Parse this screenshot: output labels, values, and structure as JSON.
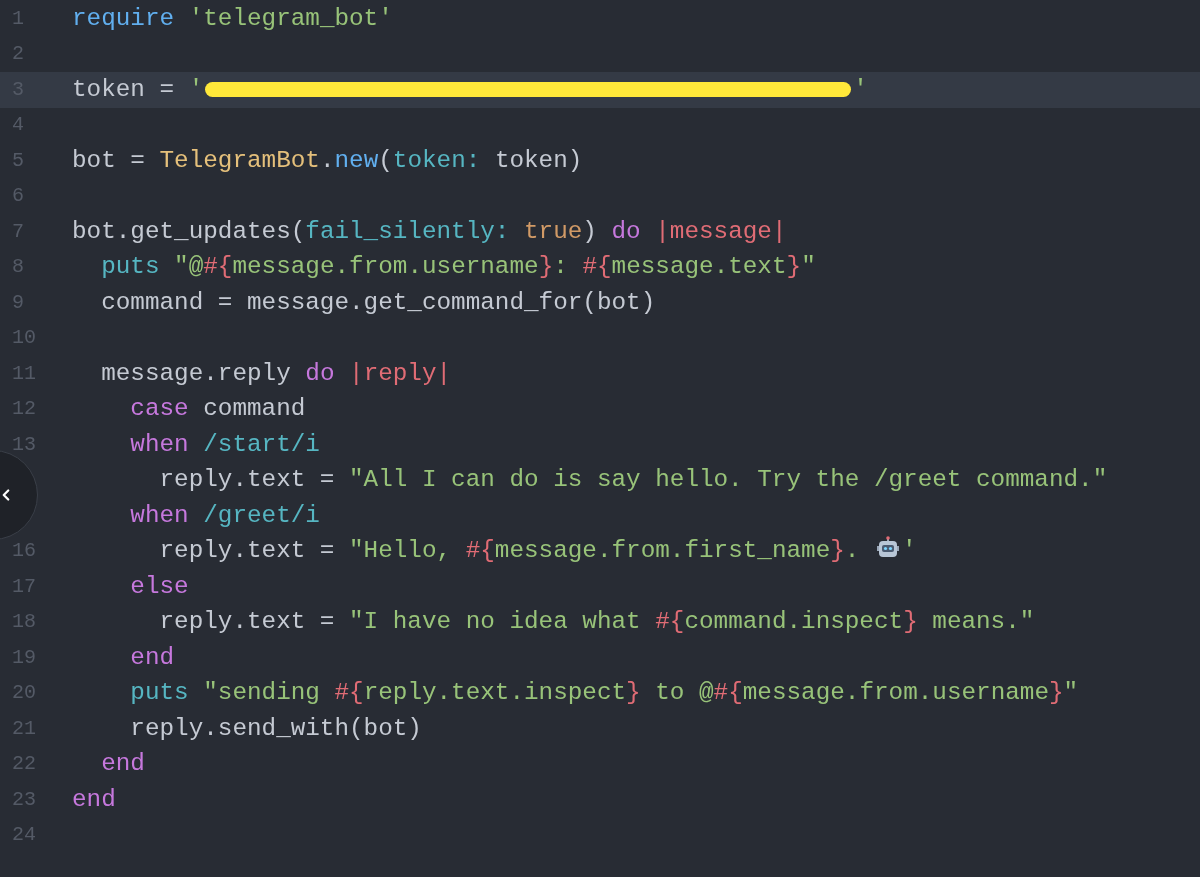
{
  "editor": {
    "lines": [
      {
        "number": "1",
        "current": false,
        "tokens": [
          {
            "kind": "function",
            "text": "require "
          },
          {
            "kind": "string",
            "text": "'telegram_bot'"
          }
        ]
      },
      {
        "number": "2",
        "current": false
      },
      {
        "number": "3",
        "current": true,
        "tokens": [
          {
            "kind": "plain",
            "text": "token = "
          },
          {
            "kind": "string",
            "text": "'"
          },
          {
            "kind": "redacted"
          },
          {
            "kind": "string",
            "text": "'"
          }
        ]
      },
      {
        "number": "4",
        "current": false
      },
      {
        "number": "5",
        "current": false,
        "tokens": [
          {
            "kind": "plain",
            "text": "bot = "
          },
          {
            "kind": "constant",
            "text": "TelegramBot"
          },
          {
            "kind": "plain",
            "text": "."
          },
          {
            "kind": "function",
            "text": "new"
          },
          {
            "kind": "plain",
            "text": "("
          },
          {
            "kind": "symbol",
            "text": "token:"
          },
          {
            "kind": "plain",
            "text": " token)"
          }
        ]
      },
      {
        "number": "6",
        "current": false
      },
      {
        "number": "7",
        "current": false,
        "tokens": [
          {
            "kind": "plain",
            "text": "bot.get_updates("
          },
          {
            "kind": "symbol",
            "text": "fail_silently: "
          },
          {
            "kind": "boolean",
            "text": "true"
          },
          {
            "kind": "plain",
            "text": ") "
          },
          {
            "kind": "keyword",
            "text": "do "
          },
          {
            "kind": "interpolation",
            "text": "|message|"
          }
        ]
      },
      {
        "number": "8",
        "current": false,
        "tokens": [
          {
            "kind": "symbol",
            "text": "  puts "
          },
          {
            "kind": "string",
            "text": "\"@"
          },
          {
            "kind": "interpolation",
            "text": "#{"
          },
          {
            "kind": "string",
            "text": "message.from.username"
          },
          {
            "kind": "interpolation",
            "text": "}"
          },
          {
            "kind": "string",
            "text": ": "
          },
          {
            "kind": "interpolation",
            "text": "#{"
          },
          {
            "kind": "string",
            "text": "message.text"
          },
          {
            "kind": "interpolation",
            "text": "}"
          },
          {
            "kind": "string",
            "text": "\""
          }
        ]
      },
      {
        "number": "9",
        "current": false,
        "tokens": [
          {
            "kind": "plain",
            "text": "  command = message.get_command_for(bot)"
          }
        ]
      },
      {
        "number": "10",
        "current": false
      },
      {
        "number": "11",
        "current": false,
        "tokens": [
          {
            "kind": "plain",
            "text": "  message.reply "
          },
          {
            "kind": "keyword",
            "text": "do "
          },
          {
            "kind": "interpolation",
            "text": "|reply|"
          }
        ]
      },
      {
        "number": "12",
        "current": false,
        "tokens": [
          {
            "kind": "keyword",
            "text": "    case"
          },
          {
            "kind": "plain",
            "text": " command"
          }
        ]
      },
      {
        "number": "13",
        "current": false,
        "tokens": [
          {
            "kind": "keyword",
            "text": "    when "
          },
          {
            "kind": "symbol",
            "text": "/start/i"
          }
        ]
      },
      {
        "current": false,
        "tokens": [
          {
            "kind": "plain",
            "text": "      reply.text = "
          },
          {
            "kind": "string",
            "text": "\"All I can do is say hello. Try the /greet command.\""
          }
        ]
      },
      {
        "current": false,
        "tokens": [
          {
            "kind": "keyword",
            "text": "    when "
          },
          {
            "kind": "symbol",
            "text": "/greet/i"
          }
        ]
      },
      {
        "number": "16",
        "current": false,
        "tokens": [
          {
            "kind": "plain",
            "text": "      reply.text = "
          },
          {
            "kind": "string",
            "text": "\"Hello, "
          },
          {
            "kind": "interpolation",
            "text": "#{"
          },
          {
            "kind": "string",
            "text": "message.from.first_name"
          },
          {
            "kind": "interpolation",
            "text": "}"
          },
          {
            "kind": "string",
            "text": ". "
          },
          {
            "kind": "emoji"
          },
          {
            "kind": "string",
            "text": "'"
          }
        ]
      },
      {
        "number": "17",
        "current": false,
        "tokens": [
          {
            "kind": "keyword",
            "text": "    else"
          }
        ]
      },
      {
        "number": "18",
        "current": false,
        "tokens": [
          {
            "kind": "plain",
            "text": "      reply.text = "
          },
          {
            "kind": "string",
            "text": "\"I have no idea what "
          },
          {
            "kind": "interpolation",
            "text": "#{"
          },
          {
            "kind": "string",
            "text": "command.inspect"
          },
          {
            "kind": "interpolation",
            "text": "}"
          },
          {
            "kind": "string",
            "text": " means.\""
          }
        ]
      },
      {
        "number": "19",
        "current": false,
        "tokens": [
          {
            "kind": "keyword",
            "text": "    end"
          }
        ]
      },
      {
        "number": "20",
        "current": false,
        "tokens": [
          {
            "kind": "symbol",
            "text": "    puts "
          },
          {
            "kind": "string",
            "text": "\"sending "
          },
          {
            "kind": "interpolation",
            "text": "#{"
          },
          {
            "kind": "string",
            "text": "reply.text.inspect"
          },
          {
            "kind": "interpolation",
            "text": "}"
          },
          {
            "kind": "string",
            "text": " to @"
          },
          {
            "kind": "interpolation",
            "text": "#{"
          },
          {
            "kind": "string",
            "text": "message.from.username"
          },
          {
            "kind": "interpolation",
            "text": "}"
          },
          {
            "kind": "string",
            "text": "\""
          }
        ]
      },
      {
        "number": "21",
        "current": false,
        "tokens": [
          {
            "kind": "plain",
            "text": "    reply.send_with(bot)"
          }
        ]
      },
      {
        "number": "22",
        "current": false,
        "tokens": [
          {
            "kind": "keyword",
            "text": "  end"
          }
        ]
      },
      {
        "number": "23",
        "current": false,
        "tokens": [
          {
            "kind": "keyword",
            "text": "end"
          }
        ]
      },
      {
        "number": "24",
        "current": false
      }
    ]
  }
}
